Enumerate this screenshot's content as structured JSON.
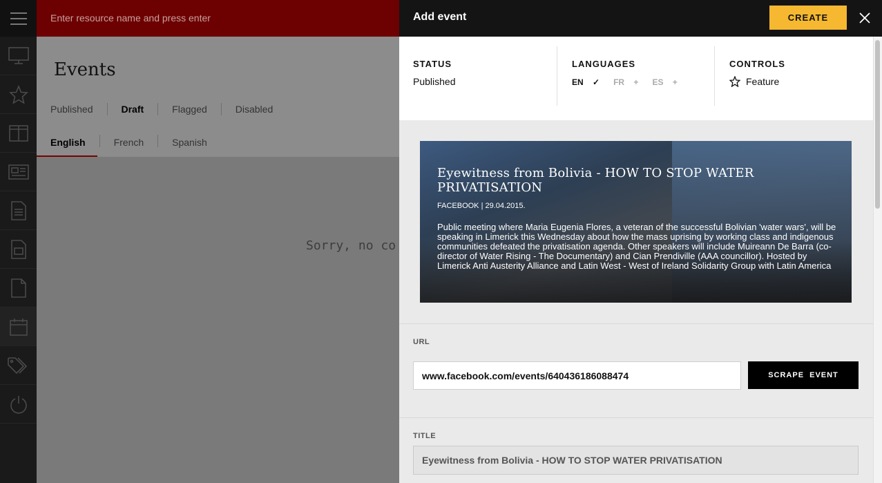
{
  "search": {
    "placeholder": "Enter resource name and press enter"
  },
  "rail": {
    "icons": [
      "menu-icon",
      "desktop-icon",
      "star-icon",
      "columns-icon",
      "newspaper-icon",
      "document-icon",
      "image-doc-icon",
      "page-icon",
      "calendar-icon",
      "tags-icon",
      "power-icon"
    ]
  },
  "main": {
    "title": "Events",
    "status_tabs": [
      "Published",
      "Draft",
      "Flagged",
      "Disabled"
    ],
    "active_status": "Draft",
    "lang_tabs": [
      "English",
      "French",
      "Spanish"
    ],
    "active_lang": "English",
    "empty_message": "Sorry, no co"
  },
  "panel": {
    "title": "Add event",
    "create_label": "CREATE",
    "status": {
      "label": "STATUS",
      "value": "Published"
    },
    "languages": {
      "label": "LANGUAGES",
      "items": [
        {
          "code": "EN",
          "mark": "✓",
          "enabled": true
        },
        {
          "code": "FR",
          "mark": "+",
          "enabled": false
        },
        {
          "code": "ES",
          "mark": "+",
          "enabled": false
        }
      ]
    },
    "controls": {
      "label": "CONTROLS",
      "feature_label": "Feature"
    },
    "preview": {
      "title": "Eyewitness from Bolivia - HOW TO STOP WATER PRIVATISATION",
      "source": "FACEBOOK | 29.04.2015.",
      "description": "Public meeting where Maria Eugenia Flores, a veteran of the successful Bolivian 'water wars', will be speaking in Limerick this Wednesday about how the mass uprising by working class and indigenous communities defeated the privatisation agenda. Other speakers will include Muireann De Barra (co-director of Water Rising - The Documentary) and Cian Prendiville (AAA councillor). Hosted by Limerick Anti Austerity Alliance and Latin West - West of Ireland Solidarity Group with Latin America"
    },
    "url": {
      "label": "URL",
      "value": "www.facebook.com/events/640436186088474",
      "scrape_label": "SCRAPE EVENT"
    },
    "title_field": {
      "label": "TITLE",
      "value": "Eyewitness from Bolivia - HOW TO STOP WATER PRIVATISATION"
    }
  },
  "colors": {
    "accent": "#f6b830",
    "brand": "#6d0000",
    "header": "#141414"
  }
}
